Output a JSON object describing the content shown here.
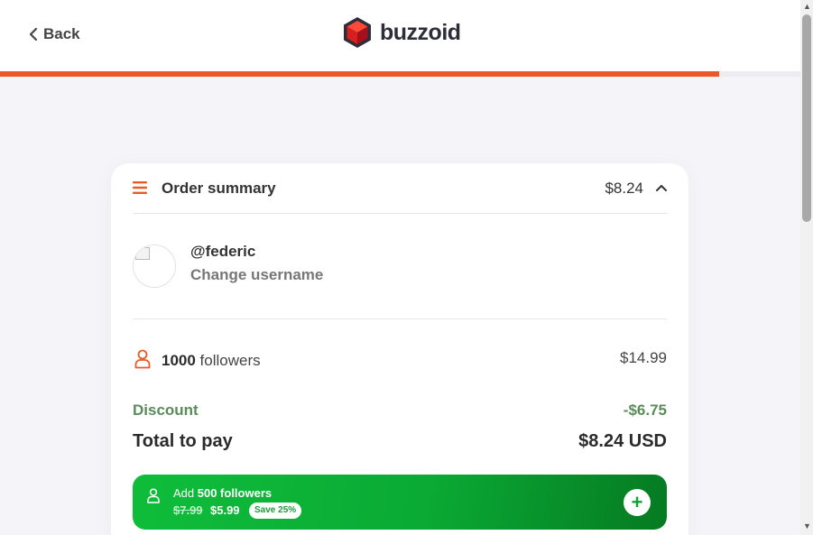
{
  "header": {
    "back_label": "Back",
    "logo_text": "buzzoid",
    "progress_fraction": 0.898
  },
  "colors": {
    "accent": "#e95a26",
    "discount": "#5b8a5b",
    "upsell_green": "#0fbd3a"
  },
  "summary": {
    "title": "Order summary",
    "price": "$8.24",
    "username": "@federic",
    "change_username": "Change username",
    "item_quantity": "1000",
    "item_unit": " followers",
    "item_price": "$14.99",
    "discount_label": "Discount",
    "discount_value": "-$6.75",
    "total_label": "Total to pay",
    "total_value": "$8.24 USD"
  },
  "upsell": {
    "prefix": "Add ",
    "offer": "500 followers",
    "old_price": "$7.99",
    "new_price": "$5.99",
    "badge": "Save 25%",
    "add_symbol": "+"
  },
  "icons": [
    "chevron-left-icon",
    "buzzoid-logo-icon",
    "menu-icon",
    "chevron-up-icon",
    "person-icon",
    "plus-icon"
  ]
}
